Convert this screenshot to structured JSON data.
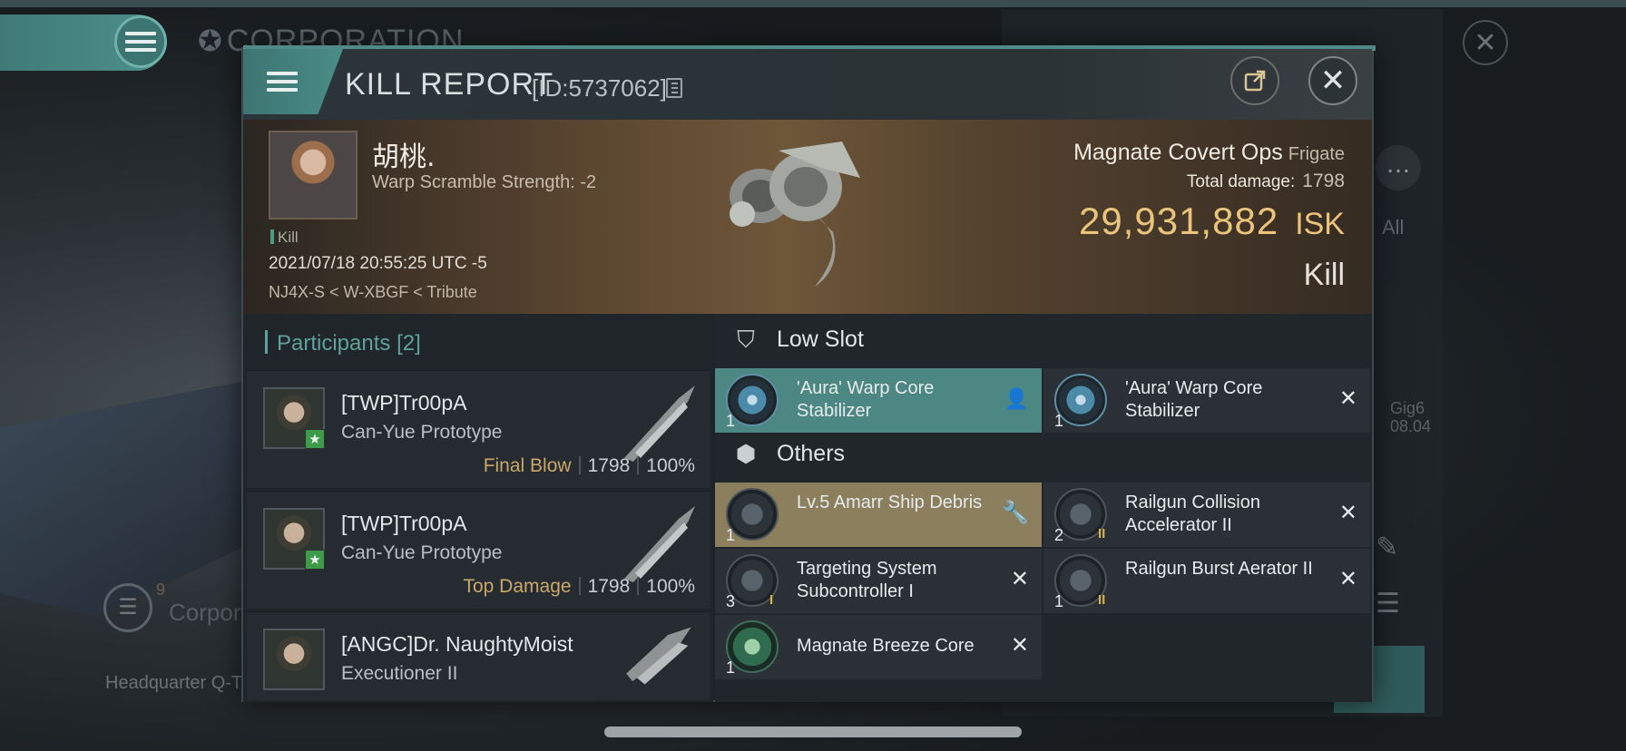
{
  "background": {
    "corp_title": "CORPORATION",
    "right_all": "All",
    "right_gig": "Gig6",
    "right_date": "08.04",
    "corp_count": "9",
    "corp_label": "Corpora",
    "hq_label": "Headquarter Q-T"
  },
  "header": {
    "title": "KILL REPORT",
    "id": "[ID:5737062]"
  },
  "victim": {
    "name": "胡桃.",
    "warp_scramble": "Warp Scramble Strength: -2",
    "kill_tag": "Kill",
    "datetime": "2021/07/18 20:55:25 UTC -5",
    "location": "NJ4X-S < W-XBGF < Tribute"
  },
  "ship": {
    "name": "Magnate Covert Ops",
    "class": "Frigate",
    "total_damage_label": "Total damage:",
    "total_damage": "1798",
    "isk_value": "29,931,882",
    "isk_unit": "ISK",
    "result": "Kill"
  },
  "participants": {
    "label": "Participants",
    "count": "[2]",
    "rows": [
      {
        "name": "[TWP]Tr00pA",
        "ship": "Can-Yue Prototype",
        "role": "Final Blow",
        "damage": "1798",
        "percent": "100%"
      },
      {
        "name": "[TWP]Tr00pA",
        "ship": "Can-Yue Prototype",
        "role": "Top Damage",
        "damage": "1798",
        "percent": "100%"
      },
      {
        "name": "[ANGC]Dr. NaughtyMoist",
        "ship": "Executioner II"
      }
    ]
  },
  "modules": {
    "low_slot_title": "Low Slot",
    "others_title": "Others",
    "low_slot": [
      {
        "qty": "1",
        "name": "'Aura' Warp Core Stabilizer",
        "status": "fitted"
      },
      {
        "qty": "1",
        "name": "'Aura' Warp Core Stabilizer",
        "status": "destroyed"
      }
    ],
    "others": [
      {
        "qty": "1",
        "name": "Lv.5 Amarr Ship Debris",
        "status": "dropped"
      },
      {
        "qty": "2",
        "name": "Railgun Collision Accelerator II",
        "tier": "II",
        "status": "destroyed"
      },
      {
        "qty": "3",
        "name": "Targeting System Subcontroller I",
        "tier": "I",
        "status": "destroyed"
      },
      {
        "qty": "1",
        "name": "Railgun Burst Aerator II",
        "tier": "II",
        "status": "destroyed"
      },
      {
        "qty": "1",
        "name": "Magnate Breeze Core",
        "status": "destroyed"
      }
    ]
  },
  "colors": {
    "accent_teal": "#4d8784",
    "isk_gold": "#e9c47a",
    "loot_gold": "#8c7f5e"
  }
}
